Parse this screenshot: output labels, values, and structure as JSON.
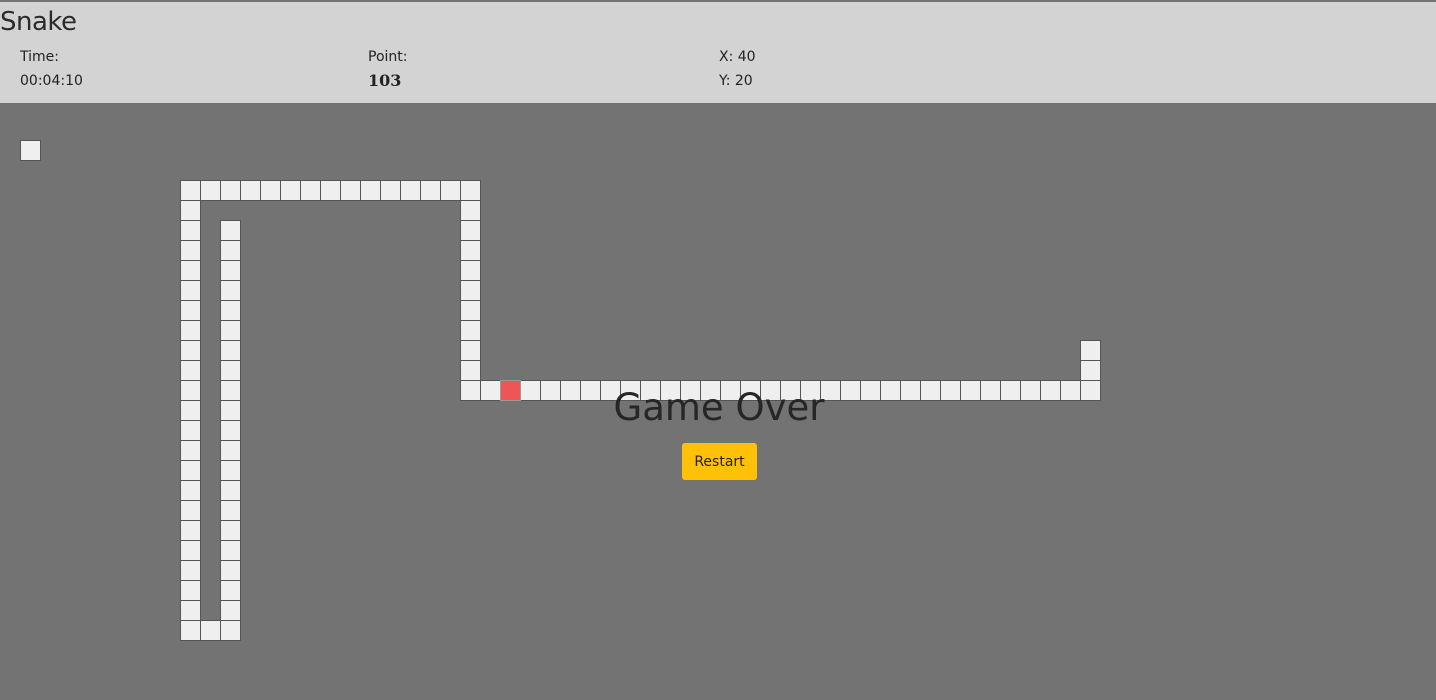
{
  "header": {
    "title": "Snake",
    "time_label": "Time:",
    "time_value": "00:04:10",
    "point_label": "Point:",
    "point_value": "103",
    "x_text": "X: 40",
    "y_text": "Y: 20"
  },
  "game": {
    "status_text": "Game Over",
    "restart_label": "Restart",
    "colors": {
      "snake": "#efefef",
      "food": "#ee5555",
      "board": "#737373",
      "header": "#d3d3d3",
      "button": "#ffc107"
    },
    "food": {
      "col": 25,
      "row": 13
    },
    "snake": [
      [
        54,
        11
      ],
      [
        54,
        12
      ],
      [
        54,
        13
      ],
      [
        53,
        13
      ],
      [
        52,
        13
      ],
      [
        51,
        13
      ],
      [
        50,
        13
      ],
      [
        49,
        13
      ],
      [
        48,
        13
      ],
      [
        47,
        13
      ],
      [
        46,
        13
      ],
      [
        45,
        13
      ],
      [
        44,
        13
      ],
      [
        43,
        13
      ],
      [
        42,
        13
      ],
      [
        41,
        13
      ],
      [
        40,
        13
      ],
      [
        39,
        13
      ],
      [
        38,
        13
      ],
      [
        37,
        13
      ],
      [
        36,
        13
      ],
      [
        35,
        13
      ],
      [
        34,
        13
      ],
      [
        33,
        13
      ],
      [
        32,
        13
      ],
      [
        31,
        13
      ],
      [
        30,
        13
      ],
      [
        29,
        13
      ],
      [
        28,
        13
      ],
      [
        27,
        13
      ],
      [
        26,
        13
      ],
      [
        24,
        13
      ],
      [
        23,
        13
      ],
      [
        23,
        12
      ],
      [
        23,
        11
      ],
      [
        23,
        10
      ],
      [
        23,
        9
      ],
      [
        23,
        8
      ],
      [
        23,
        7
      ],
      [
        23,
        6
      ],
      [
        23,
        5
      ],
      [
        23,
        4
      ],
      [
        23,
        3
      ],
      [
        22,
        3
      ],
      [
        21,
        3
      ],
      [
        20,
        3
      ],
      [
        19,
        3
      ],
      [
        18,
        3
      ],
      [
        17,
        3
      ],
      [
        16,
        3
      ],
      [
        15,
        3
      ],
      [
        14,
        3
      ],
      [
        13,
        3
      ],
      [
        12,
        3
      ],
      [
        11,
        3
      ],
      [
        10,
        3
      ],
      [
        9,
        3
      ],
      [
        9,
        4
      ],
      [
        9,
        5
      ],
      [
        9,
        6
      ],
      [
        9,
        7
      ],
      [
        9,
        8
      ],
      [
        9,
        9
      ],
      [
        9,
        10
      ],
      [
        9,
        11
      ],
      [
        9,
        12
      ],
      [
        9,
        13
      ],
      [
        9,
        14
      ],
      [
        9,
        15
      ],
      [
        9,
        16
      ],
      [
        9,
        17
      ],
      [
        9,
        18
      ],
      [
        9,
        19
      ],
      [
        9,
        20
      ],
      [
        9,
        21
      ],
      [
        9,
        22
      ],
      [
        9,
        23
      ],
      [
        9,
        24
      ],
      [
        9,
        25
      ],
      [
        10,
        25
      ],
      [
        11,
        25
      ],
      [
        11,
        24
      ],
      [
        11,
        23
      ],
      [
        11,
        22
      ],
      [
        11,
        21
      ],
      [
        11,
        20
      ],
      [
        11,
        19
      ],
      [
        11,
        18
      ],
      [
        11,
        17
      ],
      [
        11,
        16
      ],
      [
        11,
        15
      ],
      [
        11,
        14
      ],
      [
        11,
        13
      ],
      [
        11,
        12
      ],
      [
        11,
        11
      ],
      [
        11,
        10
      ],
      [
        11,
        9
      ],
      [
        11,
        8
      ],
      [
        11,
        7
      ],
      [
        11,
        6
      ],
      [
        11,
        5
      ],
      [
        1,
        1
      ]
    ]
  }
}
